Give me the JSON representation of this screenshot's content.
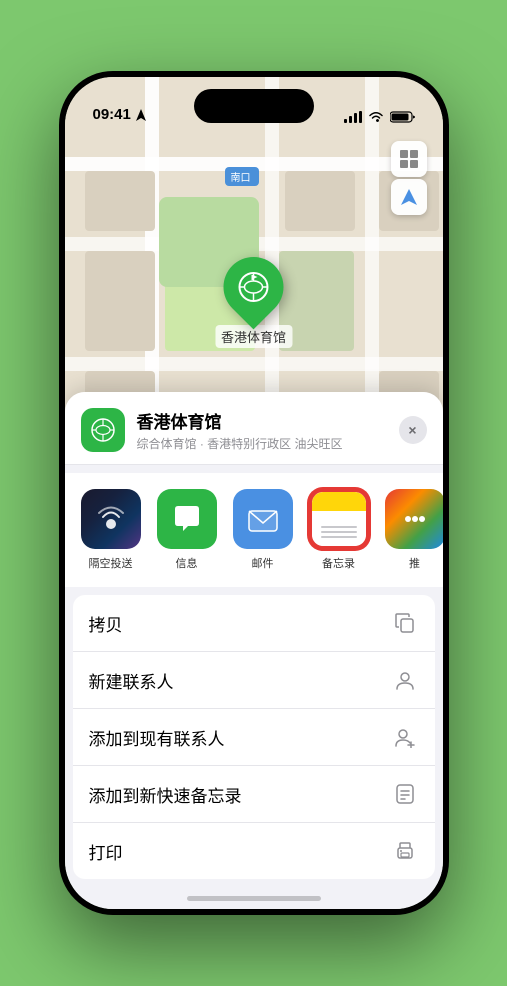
{
  "status": {
    "time": "09:41",
    "location_arrow": "▲"
  },
  "map": {
    "south_gate_label": "南口",
    "stadium_name": "香港体育馆"
  },
  "location_card": {
    "name": "香港体育馆",
    "subtitle": "综合体育馆 · 香港特别行政区 油尖旺区",
    "close_label": "×"
  },
  "share_items": [
    {
      "id": "airdrop",
      "label": "隔空投送",
      "type": "airdrop"
    },
    {
      "id": "message",
      "label": "信息",
      "type": "message"
    },
    {
      "id": "mail",
      "label": "邮件",
      "type": "mail"
    },
    {
      "id": "notes",
      "label": "备忘录",
      "type": "notes"
    },
    {
      "id": "more",
      "label": "推",
      "type": "more-dots"
    }
  ],
  "actions": [
    {
      "id": "copy",
      "label": "拷贝",
      "icon": "copy"
    },
    {
      "id": "new-contact",
      "label": "新建联系人",
      "icon": "person"
    },
    {
      "id": "add-existing",
      "label": "添加到现有联系人",
      "icon": "person-plus"
    },
    {
      "id": "add-notes",
      "label": "添加到新快速备忘录",
      "icon": "note"
    },
    {
      "id": "print",
      "label": "打印",
      "icon": "print"
    }
  ]
}
